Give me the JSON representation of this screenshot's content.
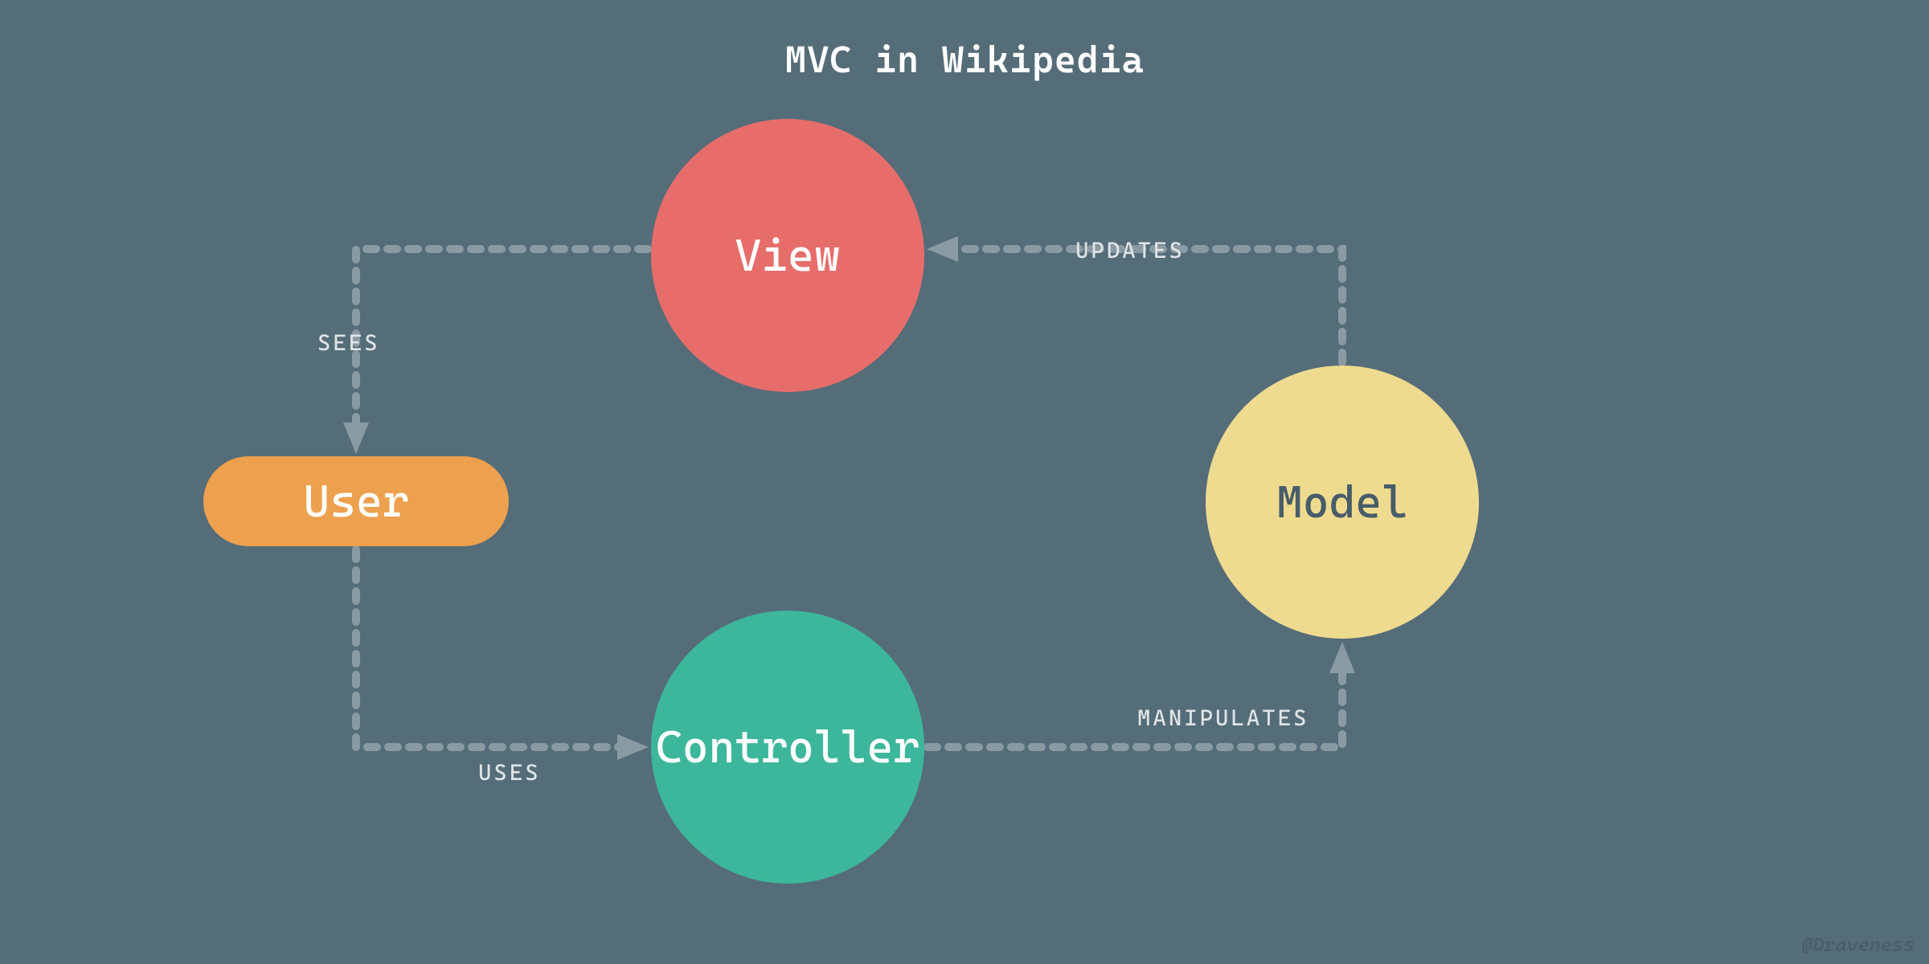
{
  "title": "MVC in Wikipedia",
  "nodes": {
    "view": "View",
    "model": "Model",
    "controller": "Controller",
    "user": "User"
  },
  "edges": {
    "sees": "SEES",
    "uses": "USES",
    "updates": "UPDATES",
    "manipulates": "MANIPULATES"
  },
  "attribution": "@Draveness",
  "colors": {
    "background": "#556d79",
    "view": "#e76d6b",
    "model": "#efdb90",
    "controller": "#3cb79b",
    "user": "#eda04d",
    "arrow": "#8a9aa3",
    "title_text": "#ffffff",
    "label_text": "#dfe4e6"
  }
}
